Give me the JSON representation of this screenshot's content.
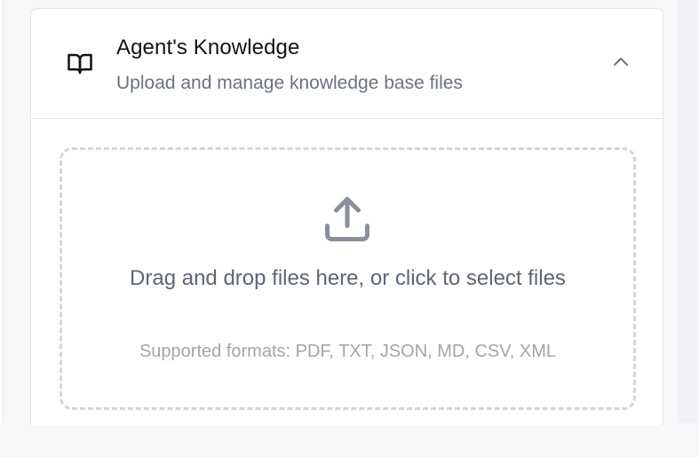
{
  "knowledge_card": {
    "title": "Agent's Knowledge",
    "subtitle": "Upload and manage knowledge base files",
    "header_icon": "book-open-icon",
    "toggle_icon": "chevron-up-icon",
    "expanded": true
  },
  "dropzone": {
    "icon": "upload-icon",
    "instruction": "Drag and drop files here, or click to select files",
    "formats": "Supported formats: PDF, TXT, JSON, MD, CSV, XML"
  }
}
